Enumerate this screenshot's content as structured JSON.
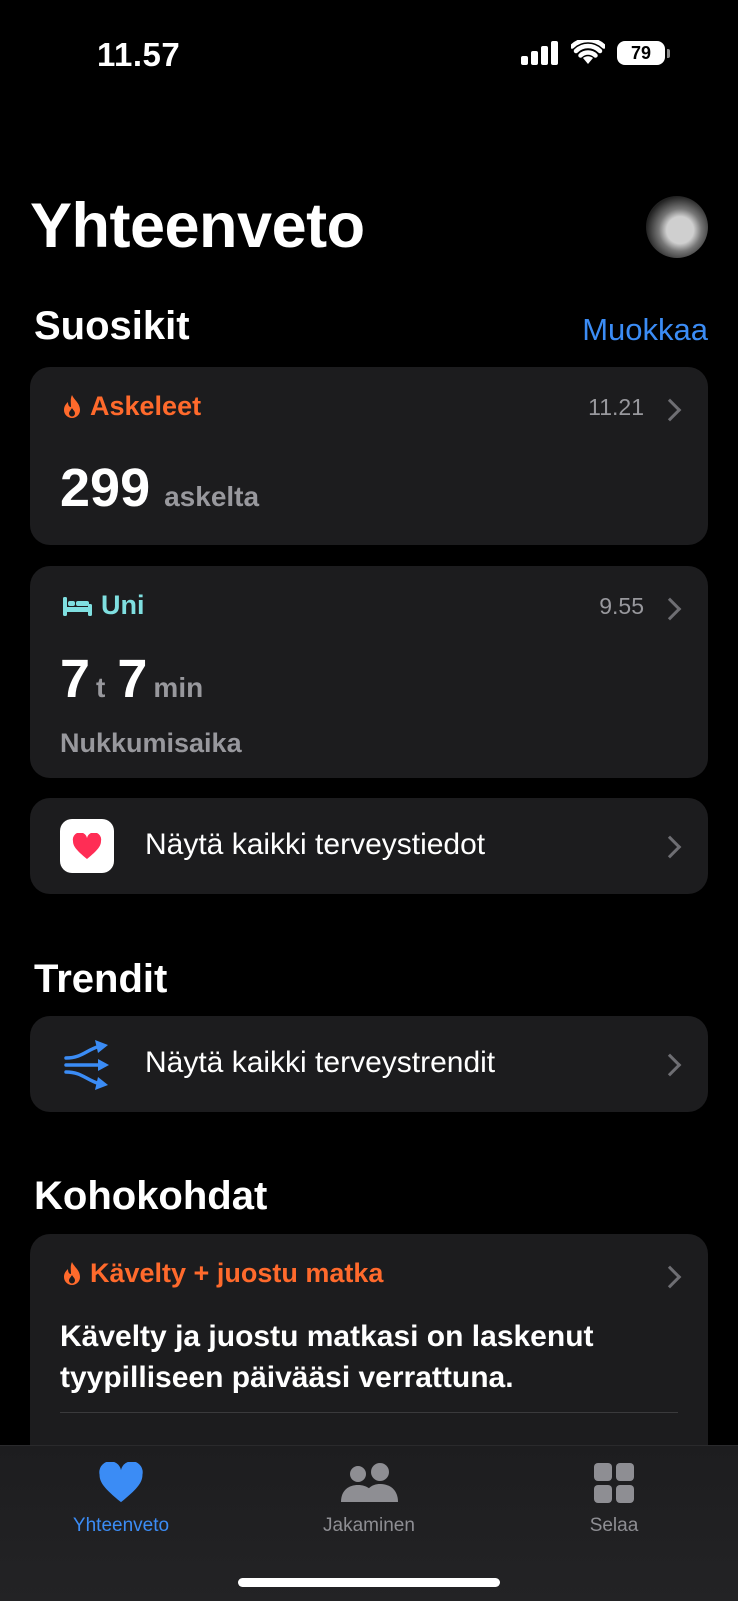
{
  "status_bar": {
    "time": "11.57",
    "battery": "79"
  },
  "header": {
    "title": "Yhteenveto"
  },
  "favorites": {
    "title": "Suosikit",
    "edit_label": "Muokkaa",
    "steps": {
      "title": "Askeleet",
      "time": "11.21",
      "value": "299",
      "unit": "askelta",
      "color": "#ff6a2c"
    },
    "sleep": {
      "title": "Uni",
      "time": "9.55",
      "hours": "7",
      "hours_unit": "t",
      "minutes": "7",
      "minutes_unit": "min",
      "caption": "Nukkumisaika",
      "color": "#7fdfe0"
    },
    "all_health_label": "Näytä kaikki terveystiedot"
  },
  "trends": {
    "title": "Trendit",
    "all_trends_label": "Näytä kaikki terveystrendit"
  },
  "highlights": {
    "title": "Kohokohdat",
    "card_title": "Kävelty + juostu matka",
    "body": "Kävelty ja juostu matkasi on laskenut tyypilliseen päivääsi verrattuna."
  },
  "tab_bar": {
    "tabs": [
      {
        "label": "Yhteenveto",
        "icon": "heart-icon",
        "active": true
      },
      {
        "label": "Jakaminen",
        "icon": "people-icon",
        "active": false
      },
      {
        "label": "Selaa",
        "icon": "grid-icon",
        "active": false
      }
    ],
    "active_color": "#3b8cf5"
  }
}
